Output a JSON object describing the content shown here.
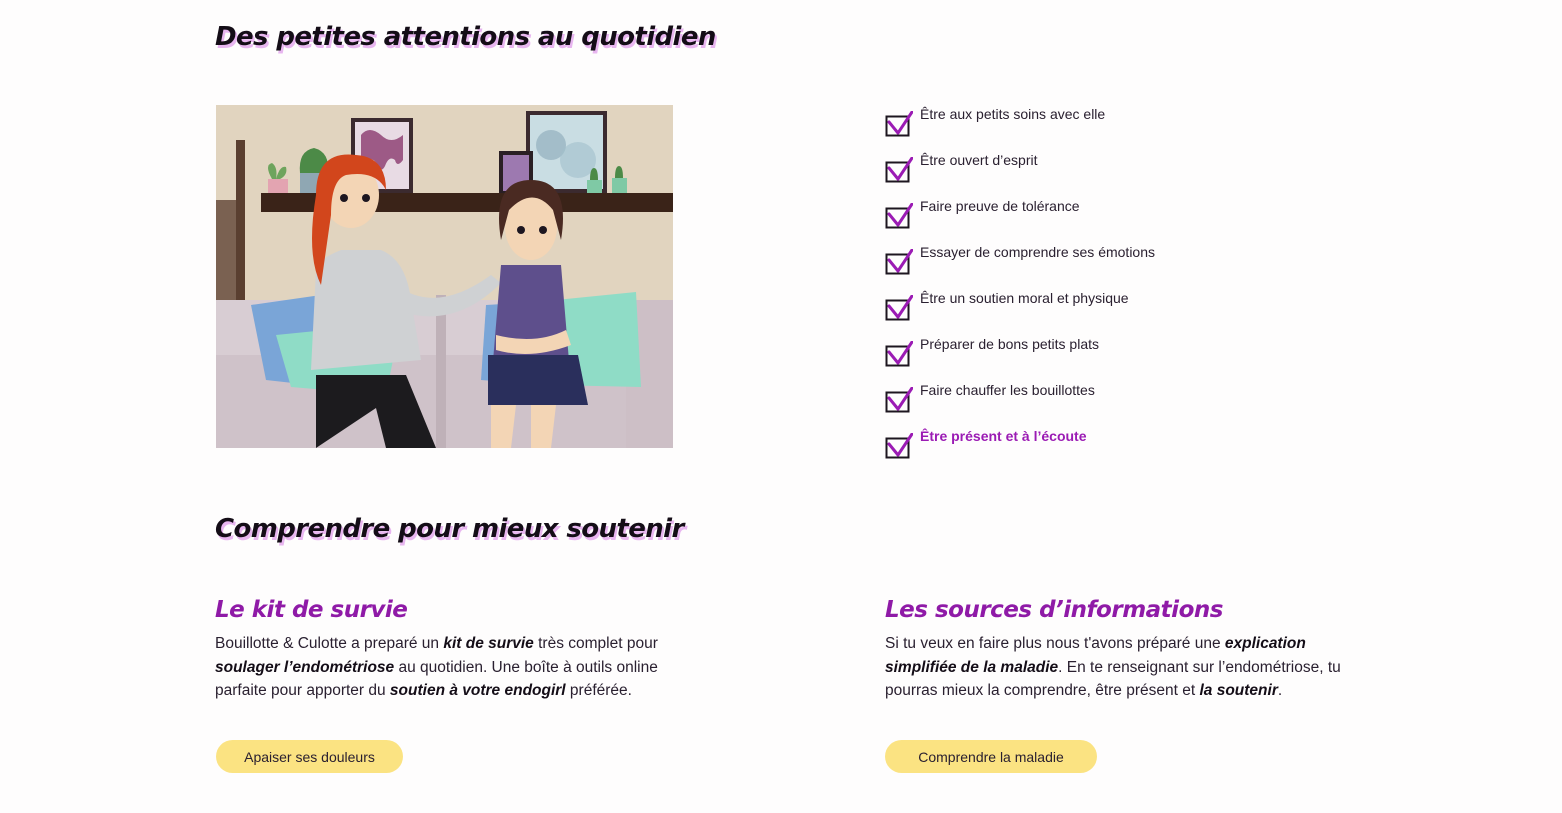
{
  "section1": {
    "title": "Des petites attentions au quotidien"
  },
  "checklist": [
    {
      "label": "Être aux petits soins avec elle",
      "checked": true
    },
    {
      "label": "Être ouvert d’esprit",
      "checked": true
    },
    {
      "label": "Faire preuve de tolérance",
      "checked": true
    },
    {
      "label": "Essayer de comprendre ses émotions",
      "checked": true
    },
    {
      "label": "Être un soutien moral et physique",
      "checked": true
    },
    {
      "label": "Préparer de bons petits plats",
      "checked": true
    },
    {
      "label": "Faire chauffer les bouillottes",
      "checked": true
    },
    {
      "label": "Être présent et à l’écoute",
      "checked": true,
      "highlight": true
    }
  ],
  "section2": {
    "title": "Comprendre pour mieux soutenir"
  },
  "kit": {
    "title": "Le kit de survie",
    "text": [
      "Bouillotte & Culotte a preparé un ",
      "kit de survie",
      " très complet pour ",
      "soulager l’endométriose",
      " au quotidien. Une boîte à outils online parfaite pour apporter du ",
      "soutien à votre endogirl",
      " préférée."
    ],
    "button": "Apaiser ses douleurs"
  },
  "sources": {
    "title": "Les sources d’informations",
    "text": [
      "Si tu veux en faire plus nous t'avons préparé une ",
      "explication simplifiée de la maladie",
      ". En te renseignant sur l’endométriose, tu pourras mieux la comprendre, être présent et ",
      "la soutenir",
      "."
    ],
    "button": "Comprendre la maladie"
  },
  "colors": {
    "accent_purple": "#8f1aa7",
    "button_yellow": "#fbe382",
    "title_shadow": "#e8b6f0"
  },
  "icons": {
    "check": "checkbox-checked-icon"
  }
}
